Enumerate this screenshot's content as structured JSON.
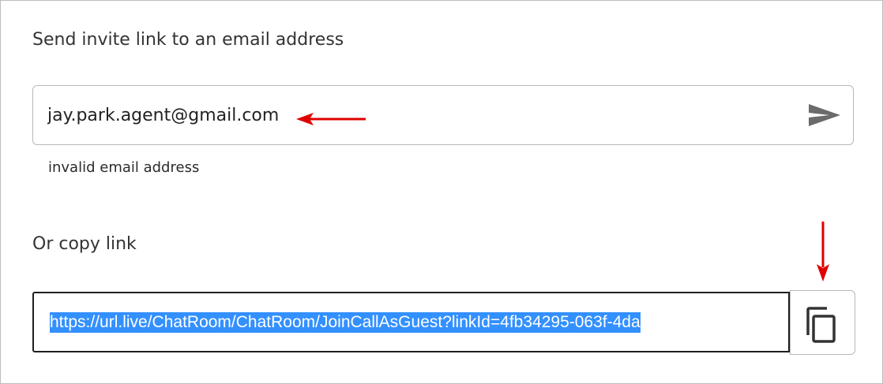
{
  "invite": {
    "email_section_label": "Send invite link to an email address",
    "email_value": "jay.park.agent@gmail.com",
    "error_message": "invalid email address",
    "copy_section_label": "Or copy link",
    "link_value": "https://url.live/ChatRoom/ChatRoom/JoinCallAsGuest?linkId=4fb34295-063f-4da"
  },
  "icons": {
    "send": "send-icon",
    "copy": "copy-icon"
  },
  "colors": {
    "selection": "#3390ff",
    "annotation_arrow": "#e00000",
    "icon_gray": "#6b6b6b",
    "icon_dark": "#333333"
  }
}
